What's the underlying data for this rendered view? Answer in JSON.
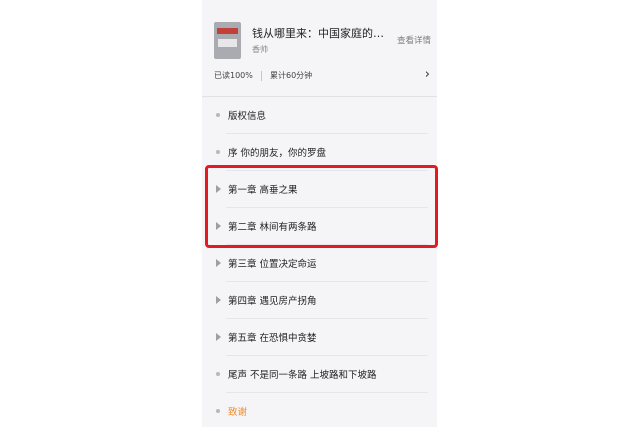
{
  "book": {
    "title": "钱从哪里来：中国家庭的…",
    "author": "香帅",
    "details_link": "查看详情"
  },
  "progress": {
    "read": "已读100%",
    "cumulative_time": "累计60分钟"
  },
  "toc": [
    {
      "label": "版权信息",
      "marker": "bullet",
      "accent": false
    },
    {
      "label": "序 你的朋友，你的罗盘",
      "marker": "bullet",
      "accent": false
    },
    {
      "label": "第一章 高垂之果",
      "marker": "arrow",
      "accent": false
    },
    {
      "label": "第二章 林间有两条路",
      "marker": "arrow",
      "accent": false
    },
    {
      "label": "第三章 位置决定命运",
      "marker": "arrow",
      "accent": false
    },
    {
      "label": "第四章 遇见房产拐角",
      "marker": "arrow",
      "accent": false
    },
    {
      "label": "第五章 在恐惧中贪婪",
      "marker": "arrow",
      "accent": false
    },
    {
      "label": "尾声 不是同一条路 上坡路和下坡路",
      "marker": "bullet",
      "accent": false
    },
    {
      "label": "致谢",
      "marker": "bullet",
      "accent": true
    }
  ],
  "colors": {
    "panel_bg": "#f5f5f7",
    "accent": "#f08a29",
    "highlight": "#e21b22"
  },
  "icons": {
    "expand": "chevron-right-icon",
    "bullet": "dot-icon",
    "collapsed_chapter": "triangle-right-icon"
  }
}
